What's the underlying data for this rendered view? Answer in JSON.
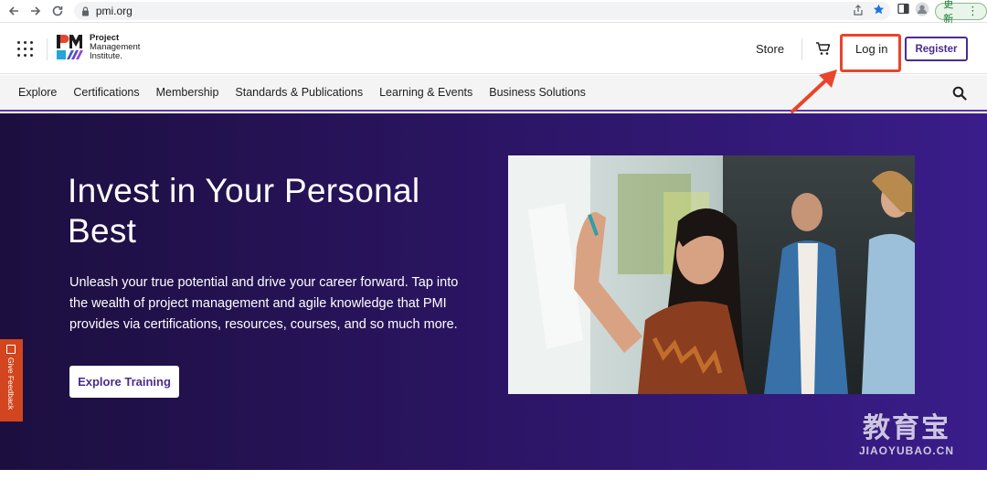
{
  "browser": {
    "url": "pmi.org",
    "update_label": "更新"
  },
  "header": {
    "logo_lines": [
      "Project",
      "Management",
      "Institute."
    ],
    "store_label": "Store",
    "login_label": "Log in",
    "register_label": "Register"
  },
  "nav": {
    "items": [
      "Explore",
      "Certifications",
      "Membership",
      "Standards & Publications",
      "Learning & Events",
      "Business Solutions"
    ]
  },
  "hero": {
    "title": "Invest in Your Personal Best",
    "body": "Unleash your true potential and drive your career forward. Tap into the wealth of project management and agile knowledge that PMI provides via certifications, resources, courses, and so much more.",
    "cta_label": "Explore Training"
  },
  "feedback": {
    "label": "Give Feedback"
  },
  "watermark": {
    "cn": "教育宝",
    "en": "JIAOYUBAO.CN"
  },
  "colors": {
    "brand_purple": "#4a2c8f",
    "hero_dark": "#1c0f3f",
    "hero_light": "#3a1d8a",
    "annotation": "#e8452c",
    "feedback": "#d2451e"
  }
}
